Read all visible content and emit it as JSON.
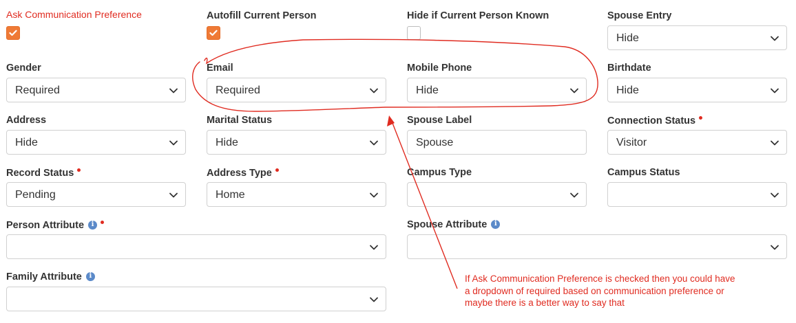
{
  "labels": {
    "ask_comm_pref": "Ask Communication Preference",
    "autofill": "Autofill Current Person",
    "hide_if_known": "Hide if Current Person Known",
    "spouse_entry": "Spouse Entry",
    "gender": "Gender",
    "email": "Email",
    "mobile_phone": "Mobile Phone",
    "birthdate": "Birthdate",
    "address": "Address",
    "marital_status": "Marital Status",
    "spouse_label": "Spouse Label",
    "connection_status": "Connection Status",
    "record_status": "Record Status",
    "address_type": "Address Type",
    "campus_type": "Campus Type",
    "campus_status": "Campus Status",
    "person_attribute": "Person Attribute",
    "spouse_attribute": "Spouse Attribute",
    "family_attribute": "Family Attribute"
  },
  "checkboxes": {
    "ask_comm_pref": true,
    "autofill": true,
    "hide_if_known": false
  },
  "values": {
    "spouse_entry": "Hide",
    "gender": "Required",
    "email": "Required",
    "mobile_phone": "Hide",
    "birthdate": "Hide",
    "address": "Hide",
    "marital_status": "Hide",
    "spouse_label": "Spouse",
    "connection_status": "Visitor",
    "record_status": "Pending",
    "address_type": "Home",
    "campus_type": "",
    "campus_status": "",
    "person_attribute": "",
    "spouse_attribute": "",
    "family_attribute": ""
  },
  "annotation": {
    "line1": "If Ask Communication Preference is checked then you could have",
    "line2": "a dropdown of required based on communication preference or",
    "line3": "maybe there is a better way to say that"
  },
  "icons": {
    "dropdown": "chevron-down-icon",
    "check": "check-icon",
    "info": "info-icon",
    "required": "required-dot"
  },
  "colors": {
    "accent": "#ef7a36",
    "annotation": "#e02b20",
    "info": "#5b8ac9"
  }
}
